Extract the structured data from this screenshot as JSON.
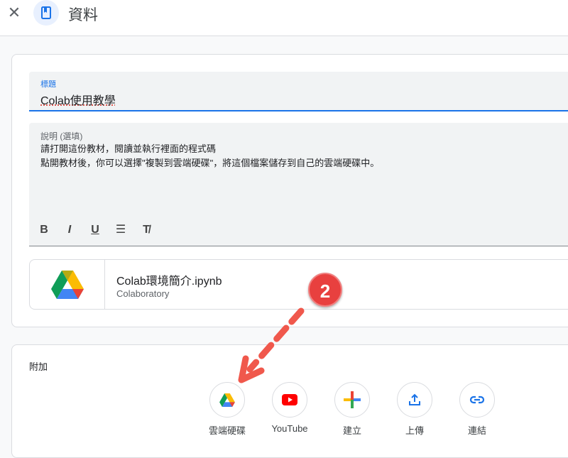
{
  "header": {
    "title": "資料"
  },
  "title_field": {
    "label": "標題",
    "value": "Colab使用教學"
  },
  "description_field": {
    "label": "說明 (選填)",
    "lines": [
      "請打開這份教材，閱讀並執行裡面的程式碼",
      "點開教材後，你可以選擇\"複製到雲端硬碟\"，將這個檔案儲存到自己的雲端硬碟中。"
    ]
  },
  "toolbar": {
    "bold": "B",
    "italic": "I",
    "underline": "U",
    "list": "☰",
    "clear": "T̸"
  },
  "attachment": {
    "name": "Colab環境簡介.ipynb",
    "type": "Colaboratory"
  },
  "attach": {
    "label": "附加",
    "buttons": [
      {
        "label": "雲端硬碟"
      },
      {
        "label": "YouTube"
      },
      {
        "label": "建立"
      },
      {
        "label": "上傳"
      },
      {
        "label": "連結"
      }
    ]
  },
  "annotation": {
    "number": "2"
  }
}
